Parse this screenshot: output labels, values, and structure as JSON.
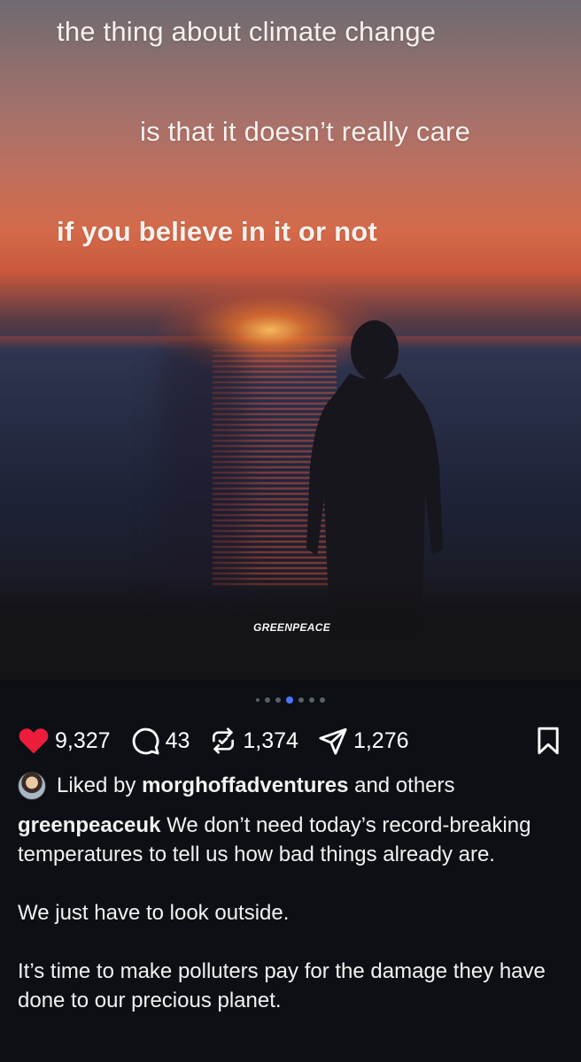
{
  "post": {
    "overlay_text": [
      "the thing about climate change",
      "is that it doesn’t really care",
      "if you believe in it or not"
    ],
    "brand_logo": "GREENPEACE"
  },
  "carousel": {
    "total": 7,
    "active_index": 3
  },
  "actions": {
    "likes": "9,327",
    "comments": "43",
    "reposts": "1,374",
    "shares": "1,276",
    "like_color": "#ed1c3b"
  },
  "liked_by": {
    "prefix": "Liked by",
    "user": "morghoffadventures",
    "suffix": "and others"
  },
  "caption": {
    "username": "greenpeaceuk",
    "paragraphs": [
      "We don’t need today’s record-breaking temperatures to tell us how bad things already are.",
      "We just have to look outside.",
      "It’s time to make polluters pay for the damage they have done to our precious planet."
    ]
  }
}
